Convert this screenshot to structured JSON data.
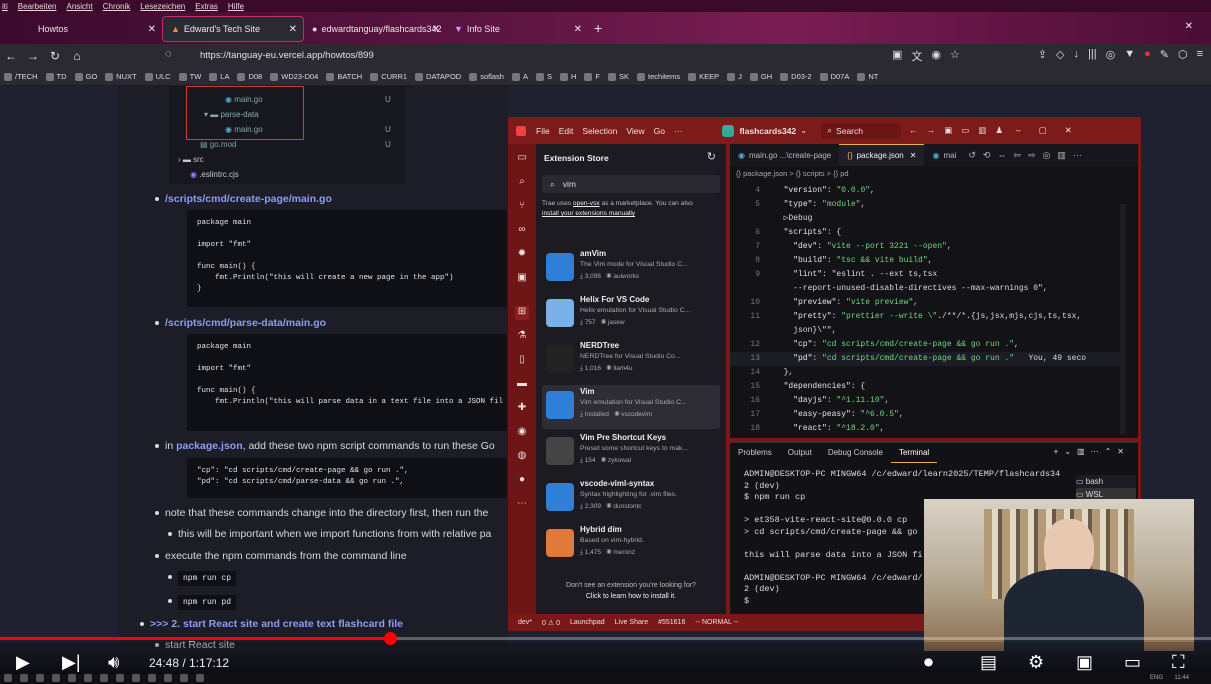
{
  "browser": {
    "menu": [
      "iti",
      "Bearbeiten",
      "Ansicht",
      "Chronik",
      "Lesezeichen",
      "Extras",
      "Hilfe"
    ],
    "tabs": [
      {
        "label": "Howtos"
      },
      {
        "label": "Edward's Tech Site"
      },
      {
        "label": "edwardtanguay/flashcards342"
      },
      {
        "label": "Info Site"
      }
    ],
    "url": "https://tanguay-eu.vercel.app/howtos/899",
    "bookmarks": [
      "/TECH",
      "TD",
      "GO",
      "NUXT",
      "ULC",
      "TW",
      "LA",
      "D08",
      "WD23-D04",
      "BATCH",
      "CURR1",
      "DATAPOD",
      "soflash",
      "A",
      "S",
      "H",
      "F",
      "SK",
      "techitems",
      "KEEP",
      "J",
      "GH",
      "D03-2",
      "D07A",
      "NT"
    ]
  },
  "page": {
    "tree": {
      "items": [
        "main.go",
        "parse-data",
        "main.go",
        "go.mod",
        "src",
        ".eslintrc.cjs"
      ],
      "flags": [
        "U",
        "U",
        "U",
        "U"
      ]
    },
    "bullets": [
      {
        "link": "/scripts/cmd/create-page/main.go"
      },
      {
        "link": "/scripts/cmd/parse-data/main.go"
      },
      {
        "pre": "in ",
        "link": "package.json",
        "post": ", add these two npm script commands to run these Go"
      },
      {
        "text": "note that these commands change into the directory first, then run the"
      },
      {
        "text": "this will be important when we import functions from with relative pa"
      },
      {
        "text": "execute the npm commands from the command line"
      },
      {
        "link": ">>> 2. start React site and create text flashcard file"
      },
      {
        "text": "start React site"
      }
    ],
    "code1": "package main\n\nimport \"fmt\"\n\nfunc main() {\n    fmt.Println(\"this will create a new page in the app\")\n}",
    "code2": "package main\n\nimport \"fmt\"\n\nfunc main() {\n    fmt.Println(\"this will parse data in a text file into a JSON fil",
    "code3": "\"cp\": \"cd scripts/cmd/create-page && go run .\",\n\"pd\": \"cd scripts/cmd/parse-data && go run .\",",
    "cmd1": "npm run cp",
    "cmd2": "npm run pd"
  },
  "vscode": {
    "menu": [
      "File",
      "Edit",
      "Selection",
      "View",
      "Go",
      "···"
    ],
    "project": "flashcards342",
    "search": "Search",
    "sidebar_title": "Extension Store",
    "search_value": "vim",
    "trae_note_pre": "Trae uses ",
    "trae_note_link": "open-vsx",
    "trae_note_post": " as a marketplace. You can also",
    "trae_note2": "install your extensions manually",
    "extensions": [
      {
        "name": "amVim",
        "desc": "The Vim mode for Visual Studio C...",
        "downloads": "3,096",
        "author": "auiworks",
        "color": "#2f7fd8"
      },
      {
        "name": "Helix For VS Code",
        "desc": "Helix emulation for Visual Studio C...",
        "downloads": "757",
        "author": "jasew",
        "color": "#7ab0e8"
      },
      {
        "name": "NERDTree",
        "desc": "NERDTree for Visual Studio Co...",
        "downloads": "1,016",
        "author": "llam4u",
        "color": "#222222"
      },
      {
        "name": "Vim",
        "desc": "Vim emulation for Visual Studio C...",
        "downloads": "Installed",
        "author": "vscodevim",
        "color": "#2f7fd8"
      },
      {
        "name": "Vim Pre Shortcut Keys",
        "desc": "Preset some shortcut keys to mak...",
        "downloads": "154",
        "author": "zykowal",
        "color": "#444444"
      },
      {
        "name": "vscode-viml-syntax",
        "desc": "Syntax highlighting for .vim files.",
        "downloads": "2,309",
        "author": "dunstontc",
        "color": "#2f7fd8"
      },
      {
        "name": "Hybrid dim",
        "desc": "Based on vim-hybrid.",
        "downloads": "1,475",
        "author": "meronz",
        "color": "#e07a3a"
      }
    ],
    "footer1": "Don't see an extension you're looking for?",
    "footer2": "Click to learn how to install it.",
    "tabs": [
      "main.go ...\\create-page",
      "package.json",
      "mai"
    ],
    "breadcrumb": "{} package.json  >  {} scripts  >  {} pd",
    "code": [
      {
        "n": "4",
        "t": "  \"version\": \"0.0.0\","
      },
      {
        "n": "5",
        "t": "  \"type\": \"module\","
      },
      {
        "n": "",
        "t": "  ▷Debug"
      },
      {
        "n": "6",
        "t": "  \"scripts\": {"
      },
      {
        "n": "7",
        "t": "    \"dev\": \"vite --port 3221 --open\","
      },
      {
        "n": "8",
        "t": "    \"build\": \"tsc && vite build\","
      },
      {
        "n": "9",
        "t": "    \"lint\": \"eslint . --ext ts,tsx"
      },
      {
        "n": "",
        "t": "    --report-unused-disable-directives --max-warnings 0\","
      },
      {
        "n": "10",
        "t": "    \"preview\": \"vite preview\","
      },
      {
        "n": "11",
        "t": "    \"pretty\": \"prettier --write \\\"./**/*.{js,jsx,mjs,cjs,ts,tsx,"
      },
      {
        "n": "",
        "t": "    json}\\\"\","
      },
      {
        "n": "12",
        "t": "    \"cp\": \"cd scripts/cmd/create-page && go run .\","
      },
      {
        "n": "13",
        "t": "    \"pd\": \"cd scripts/cmd/create-page && go run .\"   You, 49 seco"
      },
      {
        "n": "14",
        "t": "  },"
      },
      {
        "n": "15",
        "t": "  \"dependencies\": {"
      },
      {
        "n": "16",
        "t": "    \"dayjs\": \"^1.11.10\","
      },
      {
        "n": "17",
        "t": "    \"easy-peasy\": \"^6.0.5\","
      },
      {
        "n": "18",
        "t": "    \"react\": \"^18.2.0\","
      }
    ],
    "panel_tabs": [
      "Problems",
      "Output",
      "Debug Console",
      "Terminal"
    ],
    "terminal": "ADMIN@DESKTOP-PC MINGW64 /c/edward/learn2025/TEMP/flashcards34\n2 (dev)\n$ npm run cp\n\n> et358-vite-react-site@0.0.0 cp\n> cd scripts/cmd/create-page && go\n\nthis will parse data into a JSON fi\n\nADMIN@DESKTOP-PC MINGW64 /c/edward/\n2 (dev)\n$ ",
    "shells": [
      "bash",
      "WSL"
    ],
    "status": [
      "dev*",
      "0 ⚠ 0",
      "Launchpad",
      "Live Share",
      "#551616",
      "-- NORMAL --"
    ]
  },
  "player": {
    "time": "24:48 / 1:17:12",
    "progress": 0.322
  },
  "taskbar": {
    "lang": "ENG",
    "clock": "11:44"
  }
}
